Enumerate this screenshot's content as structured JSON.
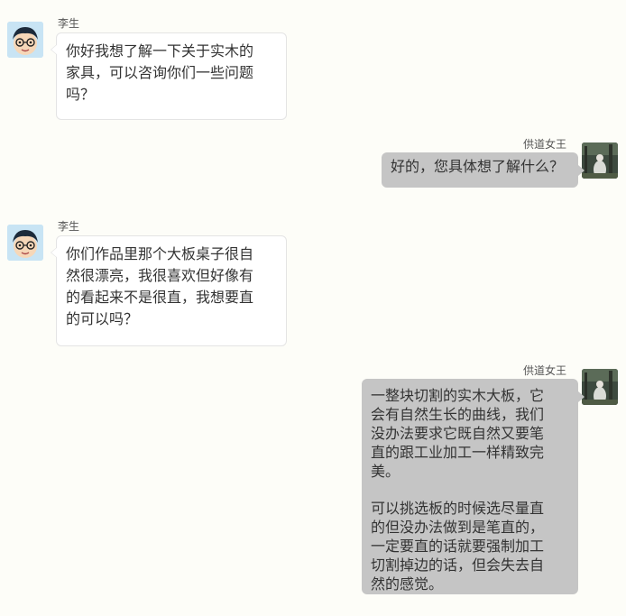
{
  "colors": {
    "background": "#fdfdf8",
    "incoming_bubble": "#ffffff",
    "outgoing_bubble": "#c5c5c5",
    "text": "#333333"
  },
  "participants": {
    "customer": {
      "name": "李生",
      "avatar_icon": "cartoon-boy-glasses-avatar-icon"
    },
    "seller": {
      "name": "供道女王",
      "avatar_icon": "forest-photo-avatar-icon"
    }
  },
  "messages": [
    {
      "sender": "李生",
      "lines": [
        "你好我想了解一下关于实木的",
        "家具，可以咨询你们一些问题",
        "吗？"
      ]
    },
    {
      "sender": "供道女王",
      "lines": [
        "好的，您具体想了解什么？"
      ]
    },
    {
      "sender": "李生",
      "lines": [
        "你们作品里那个大板桌子很自",
        "然很漂亮，我很喜欢但好像有",
        "的看起来不是很直，我想要直",
        "的可以吗？"
      ]
    },
    {
      "sender": "供道女王",
      "paragraph1": [
        "一整块切割的实木大板，它",
        "会有自然生长的曲线，我们",
        "没办法要求它既自然又要笔",
        "直的跟工业加工一样精致完",
        "美。"
      ],
      "paragraph2": [
        "可以挑选板的时候选尽量直",
        "的但没办法做到是笔直的，",
        "一定要直的话就要强制加工",
        "切割掉边的话，但会失去自",
        "然的感觉。"
      ]
    }
  ]
}
